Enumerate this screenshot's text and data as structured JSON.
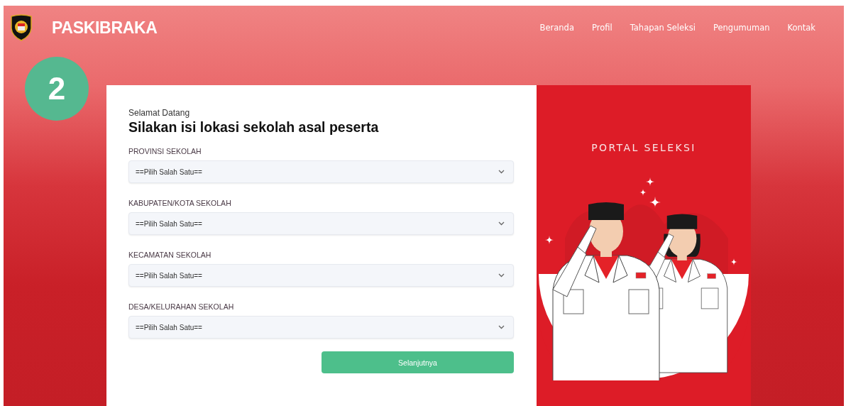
{
  "navbar": {
    "brand": "PASKIBRAKA",
    "links": [
      {
        "label": "Beranda"
      },
      {
        "label": "Profil"
      },
      {
        "label": "Tahapan Seleksi"
      },
      {
        "label": "Pengumuman"
      },
      {
        "label": "Kontak"
      }
    ]
  },
  "step_badge": "2",
  "form": {
    "greeting": "Selamat Datang",
    "heading": "Silakan isi lokasi sekolah asal peserta",
    "fields": [
      {
        "label": "PROVINSI SEKOLAH",
        "value": "==Pilih Salah Satu=="
      },
      {
        "label": "KABUPATEN/KOTA SEKOLAH",
        "value": "==Pilih Salah Satu=="
      },
      {
        "label": "KECAMATAN SEKOLAH",
        "value": "==Pilih Salah Satu=="
      },
      {
        "label": "DESA/KELURAHAN SEKOLAH",
        "value": "==Pilih Salah Satu=="
      }
    ],
    "submit": "Selanjutnya"
  },
  "banner": {
    "title": "PORTAL SELEKSI"
  }
}
